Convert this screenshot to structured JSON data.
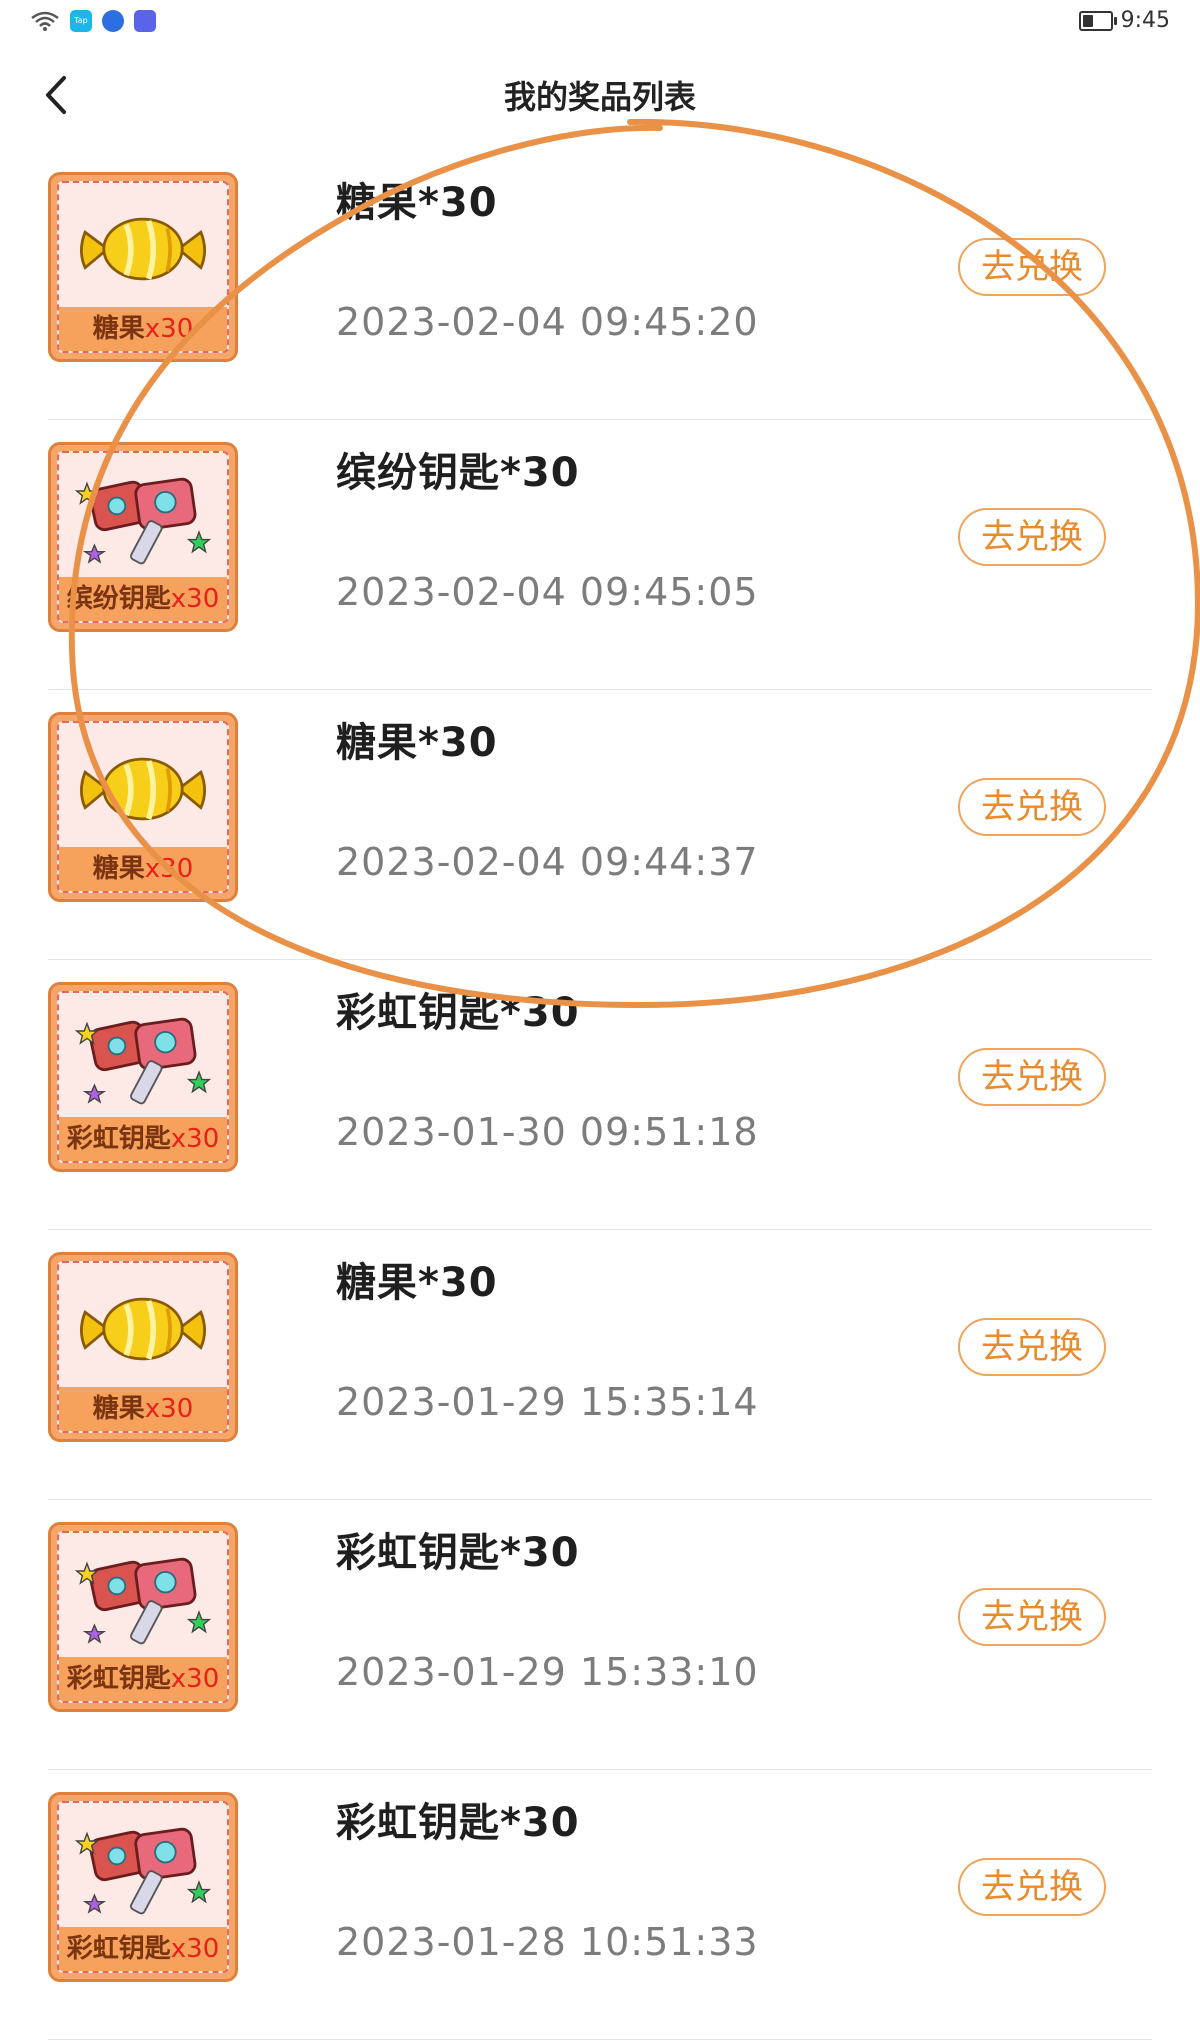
{
  "status_bar": {
    "time": "9:45",
    "app_icons": [
      "wifi-icon",
      "taptap-app-icon",
      "browser-app-icon",
      "edu-app-icon"
    ],
    "tap_icon_text": "Tap",
    "battery_level": 0.4
  },
  "header": {
    "title": "我的奖品列表",
    "back_icon": "chevron-left-icon"
  },
  "colors": {
    "accent": "#e98a2c",
    "button_border": "#f0a35a",
    "annotation": "#ea9148",
    "qty_red": "#e8201a"
  },
  "prizes": [
    {
      "name": "糖果*30",
      "time": "2023-02-04 09:45:20",
      "button": "去兑换",
      "icon": "candy-icon",
      "thumb_name": "糖果",
      "thumb_qty": "x30"
    },
    {
      "name": "缤纷钥匙*30",
      "time": "2023-02-04 09:45:05",
      "button": "去兑换",
      "icon": "key-icon",
      "thumb_name": "缤纷钥匙",
      "thumb_qty": "x30"
    },
    {
      "name": "糖果*30",
      "time": "2023-02-04 09:44:37",
      "button": "去兑换",
      "icon": "candy-icon",
      "thumb_name": "糖果",
      "thumb_qty": "x30"
    },
    {
      "name": "彩虹钥匙*30",
      "time": "2023-01-30 09:51:18",
      "button": "去兑换",
      "icon": "key-icon",
      "thumb_name": "彩虹钥匙",
      "thumb_qty": "x30"
    },
    {
      "name": "糖果*30",
      "time": "2023-01-29 15:35:14",
      "button": "去兑换",
      "icon": "candy-icon",
      "thumb_name": "糖果",
      "thumb_qty": "x30"
    },
    {
      "name": "彩虹钥匙*30",
      "time": "2023-01-29 15:33:10",
      "button": "去兑换",
      "icon": "key-icon",
      "thumb_name": "彩虹钥匙",
      "thumb_qty": "x30"
    },
    {
      "name": "彩虹钥匙*30",
      "time": "2023-01-28 10:51:33",
      "button": "去兑换",
      "icon": "key-icon",
      "thumb_name": "彩虹钥匙",
      "thumb_qty": "x30"
    }
  ]
}
